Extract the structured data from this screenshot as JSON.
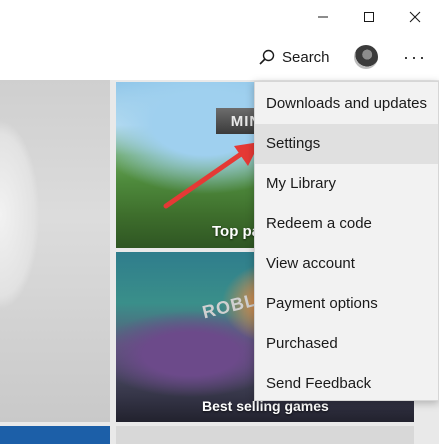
{
  "window": {
    "minimize_glyph": "—",
    "maximize_glyph": "☐",
    "close_glyph": "✕"
  },
  "header": {
    "search_label": "Search",
    "more_label": "···"
  },
  "tiles": {
    "minecraft": {
      "logo_text": "MIN",
      "caption": "Top pa"
    },
    "roblox": {
      "logo_text": "ROBL",
      "caption": "Best selling games"
    }
  },
  "menu": {
    "items": [
      {
        "label": "Downloads and updates"
      },
      {
        "label": "Settings",
        "highlighted": true
      },
      {
        "label": "My Library"
      },
      {
        "label": "Redeem a code"
      },
      {
        "label": "View account"
      },
      {
        "label": "Payment options"
      },
      {
        "label": "Purchased"
      },
      {
        "label": "Send Feedback"
      }
    ]
  },
  "colors": {
    "arrow": "#e53935",
    "menu_bg": "#f2f2f2",
    "menu_highlight": "#e0e0e0"
  },
  "icons": [
    "minimize-icon",
    "maximize-icon",
    "close-icon",
    "search-icon",
    "more-icon",
    "arrow-pointer"
  ]
}
